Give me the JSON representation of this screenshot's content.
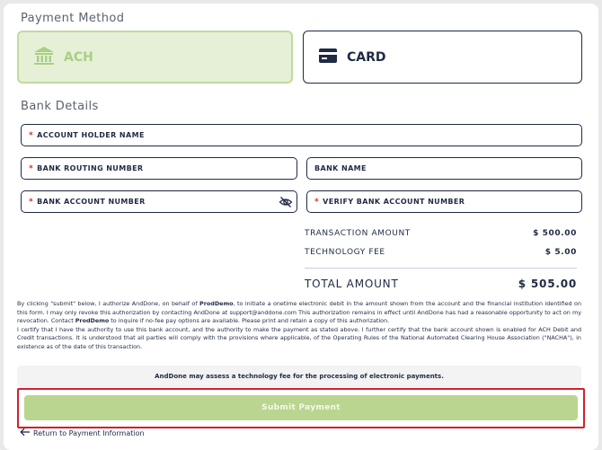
{
  "payment_method": {
    "title": "Payment Method",
    "options": [
      {
        "label": "ACH",
        "icon": "bank-icon",
        "selected": true
      },
      {
        "label": "CARD",
        "icon": "credit-card-icon",
        "selected": false
      }
    ]
  },
  "bank_details": {
    "title": "Bank Details",
    "account_holder": "ACCOUNT HOLDER NAME",
    "routing_number": "BANK ROUTING NUMBER",
    "bank_name": "BANK NAME",
    "account_number": "BANK ACCOUNT NUMBER",
    "verify_account_number": "VERIFY BANK ACCOUNT NUMBER",
    "required_mark": "*"
  },
  "summary": {
    "transaction_amount_label": "TRANSACTION AMOUNT",
    "transaction_amount_value": "$ 500.00",
    "technology_fee_label": "TECHNOLOGY FEE",
    "technology_fee_value": "$ 5.00",
    "total_label": "TOTAL AMOUNT",
    "total_value": "$ 505.00"
  },
  "legal": {
    "p1_a": "By clicking \"submit\" below, I authorize AndDone, on behalf of ",
    "p1_merchant": "ProdDemo",
    "p1_b": ", to initiate a onetime electronic debit in the amount shown from the account and the financial institution identified on this form. I may only revoke this authorization by contacting AndDone at support@anddone.com This authorization remains in effect until AndDone has had a reasonable opportunity to act on my revocation. Contact ",
    "p1_merchant2": "ProdDemo",
    "p1_c": " to inquire if no-fee pay options are available. Please print and retain a copy of this authorization.",
    "p2": "I certify that I have the authority to use this bank account, and the authority to make the payment as stated above. I further certify that the bank account shown is enabled for ACH Debit and Credit transactions. It is understood that all parties will comply with the provisions where applicable, of the Operating Rules of the National Automated Clearing House Association (\"NACHA\"), in existence as of the date of this transaction."
  },
  "notice": "AndDone may assess a technology fee for the processing of electronic payments.",
  "submit_label": "Submit Payment",
  "back_link": "Return to Payment Information",
  "colors": {
    "accent_green": "#b9d58f",
    "navy": "#1f2a44",
    "required_red": "#d62b2b",
    "highlight_red": "#d41f2b"
  }
}
